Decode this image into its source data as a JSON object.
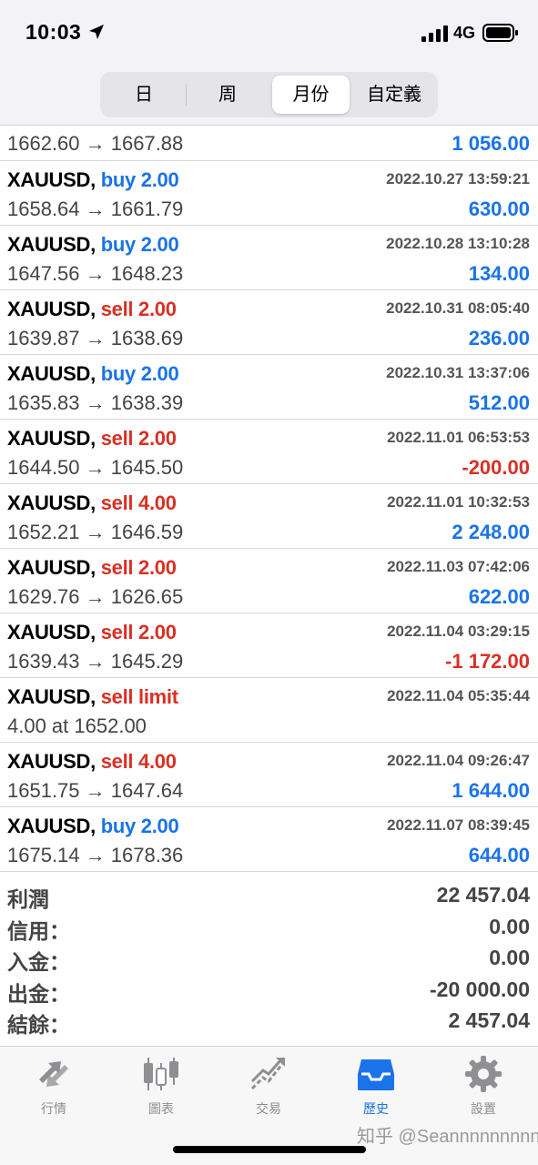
{
  "status": {
    "time": "10:03",
    "network": "4G"
  },
  "segments": [
    {
      "label": "日",
      "active": false
    },
    {
      "label": "周",
      "active": false
    },
    {
      "label": "月份",
      "active": true
    },
    {
      "label": "自定義",
      "active": false
    }
  ],
  "partial_row": {
    "prices": "1662.60 → 1667.88",
    "profit": "1 056.00"
  },
  "trades": [
    {
      "symbol": "XAUUSD,",
      "dir": "buy 2.00",
      "side": "buy",
      "time": "2022.10.27 13:59:21",
      "prices": "1658.64 → 1661.79",
      "profit": "630.00"
    },
    {
      "symbol": "XAUUSD,",
      "dir": "buy 2.00",
      "side": "buy",
      "time": "2022.10.28 13:10:28",
      "prices": "1647.56 → 1648.23",
      "profit": "134.00"
    },
    {
      "symbol": "XAUUSD,",
      "dir": "sell 2.00",
      "side": "sell",
      "time": "2022.10.31 08:05:40",
      "prices": "1639.87 → 1638.69",
      "profit": "236.00"
    },
    {
      "symbol": "XAUUSD,",
      "dir": "buy 2.00",
      "side": "buy",
      "time": "2022.10.31 13:37:06",
      "prices": "1635.83 → 1638.39",
      "profit": "512.00"
    },
    {
      "symbol": "XAUUSD,",
      "dir": "sell 2.00",
      "side": "sell",
      "time": "2022.11.01 06:53:53",
      "prices": "1644.50 → 1645.50",
      "profit": "-200.00"
    },
    {
      "symbol": "XAUUSD,",
      "dir": "sell 4.00",
      "side": "sell",
      "time": "2022.11.01 10:32:53",
      "prices": "1652.21 → 1646.59",
      "profit": "2 248.00"
    },
    {
      "symbol": "XAUUSD,",
      "dir": "sell 2.00",
      "side": "sell",
      "time": "2022.11.03 07:42:06",
      "prices": "1629.76 → 1626.65",
      "profit": "622.00"
    },
    {
      "symbol": "XAUUSD,",
      "dir": "sell 2.00",
      "side": "sell",
      "time": "2022.11.04 03:29:15",
      "prices": "1639.43 → 1645.29",
      "profit": "-1 172.00"
    },
    {
      "symbol": "XAUUSD,",
      "dir": "sell limit",
      "side": "sell",
      "time": "2022.11.04 05:35:44",
      "prices": "4.00 at 1652.00",
      "profit": ""
    },
    {
      "symbol": "XAUUSD,",
      "dir": "sell 4.00",
      "side": "sell",
      "time": "2022.11.04 09:26:47",
      "prices": "1651.75 → 1647.64",
      "profit": "1 644.00"
    },
    {
      "symbol": "XAUUSD,",
      "dir": "buy 2.00",
      "side": "buy",
      "time": "2022.11.07 08:39:45",
      "prices": "1675.14 → 1678.36",
      "profit": "644.00"
    }
  ],
  "summary": [
    {
      "label": "利潤",
      "value": "22 457.04"
    },
    {
      "label": "信用：",
      "value": "0.00"
    },
    {
      "label": "入金：",
      "value": "0.00"
    },
    {
      "label": "出金：",
      "value": "-20 000.00"
    },
    {
      "label": "結餘：",
      "value": "2 457.04"
    }
  ],
  "tabs": [
    {
      "label": "行情",
      "icon": "quotes-arrows-icon",
      "active": false
    },
    {
      "label": "圖表",
      "icon": "candlestick-chart-icon",
      "active": false
    },
    {
      "label": "交易",
      "icon": "trade-line-icon",
      "active": false
    },
    {
      "label": "歷史",
      "icon": "history-inbox-icon",
      "active": true
    },
    {
      "label": "設置",
      "icon": "gear-icon",
      "active": false
    }
  ],
  "watermark": "知乎 @Seannnnnnnnn",
  "colors": {
    "buy": "#1a73e8",
    "sell": "#d93025",
    "active_tab": "#1a73e8",
    "inactive_tab": "#8e8e93"
  }
}
